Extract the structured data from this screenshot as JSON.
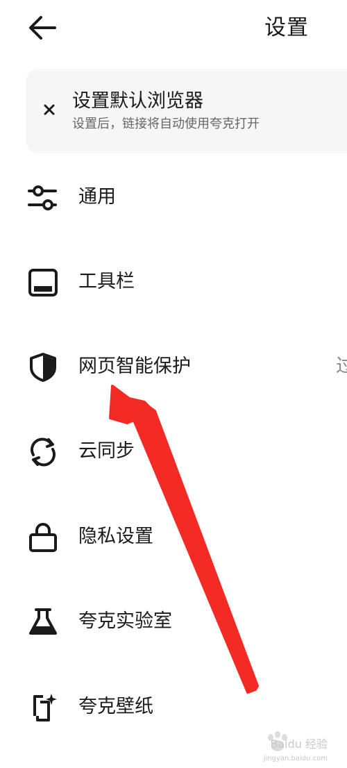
{
  "header": {
    "title": "设置",
    "back_icon": "arrow-left-icon"
  },
  "banner": {
    "title": "设置默认浏览器",
    "subtitle": "设置后，链接将自动使用夸克打开",
    "close_icon": "close-icon"
  },
  "menu": {
    "items": [
      {
        "label": "通用",
        "icon": "sliders-icon",
        "trailing": ""
      },
      {
        "label": "工具栏",
        "icon": "toolbar-icon",
        "trailing": ""
      },
      {
        "label": "网页智能保护",
        "icon": "shield-icon",
        "trailing": "过"
      },
      {
        "label": "云同步",
        "icon": "sync-icon",
        "trailing": ""
      },
      {
        "label": "隐私设置",
        "icon": "lock-icon",
        "trailing": ""
      },
      {
        "label": "夸克实验室",
        "icon": "flask-icon",
        "trailing": ""
      },
      {
        "label": "夸克壁纸",
        "icon": "wallpaper-icon",
        "trailing": ""
      }
    ]
  },
  "annotation": {
    "color": "#f42a25"
  },
  "watermark": {
    "text": "Baidu 经验",
    "url": "jingyan.baidu.com"
  }
}
